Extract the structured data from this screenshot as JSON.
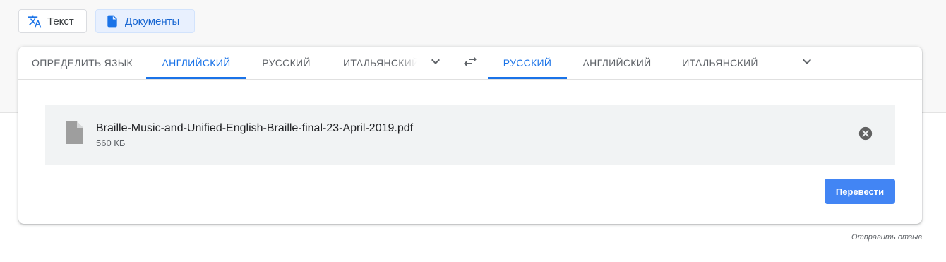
{
  "modes": {
    "text_label": "Текст",
    "documents_label": "Документы"
  },
  "source_langs": {
    "detect": "ОПРЕДЕЛИТЬ ЯЗЫК",
    "items": [
      "АНГЛИЙСКИЙ",
      "РУССКИЙ",
      "ИТАЛЬЯНСКИЙ"
    ],
    "selected": "АНГЛИЙСКИЙ"
  },
  "target_langs": {
    "items": [
      "РУССКИЙ",
      "АНГЛИЙСКИЙ",
      "ИТАЛЬЯНСКИЙ"
    ],
    "selected": "РУССКИЙ"
  },
  "icons": {
    "text_mode": "translate-icon",
    "documents_mode": "document-icon",
    "source_more": "chevron-down-icon",
    "swap": "swap-arrows-icon",
    "target_more": "chevron-down-icon",
    "file": "file-icon",
    "remove": "close-circle-icon"
  },
  "file": {
    "name": "Braille-Music-and-Unified-English-Braille-final-23-April-2019.pdf",
    "size": "560 КБ"
  },
  "actions": {
    "translate_label": "Перевести",
    "feedback_label": "Отправить отзыв"
  },
  "colors": {
    "accent": "#1a73e8",
    "button": "#4285f4",
    "selected_mode_bg": "#e8f0fe"
  }
}
